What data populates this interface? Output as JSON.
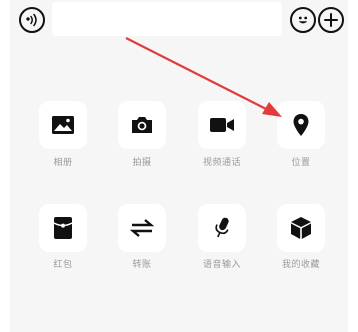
{
  "input_bar": {
    "voice_icon": "voice-icon",
    "emoji_icon": "emoji-icon",
    "plus_icon": "plus-icon"
  },
  "actions": [
    {
      "label": "相册",
      "icon": "image-icon"
    },
    {
      "label": "拍摄",
      "icon": "camera-icon"
    },
    {
      "label": "视频通话",
      "icon": "video-call-icon"
    },
    {
      "label": "位置",
      "icon": "location-pin-icon"
    },
    {
      "label": "红包",
      "icon": "red-packet-icon"
    },
    {
      "label": "转账",
      "icon": "transfer-icon"
    },
    {
      "label": "语音输入",
      "icon": "microphone-icon"
    },
    {
      "label": "我的收藏",
      "icon": "favorites-box-icon"
    }
  ],
  "colors": {
    "panel_bg": "#f6f6f6",
    "tile_bg": "#ffffff",
    "label": "#9a9a9a",
    "annotation_arrow": "#e23b3b"
  }
}
